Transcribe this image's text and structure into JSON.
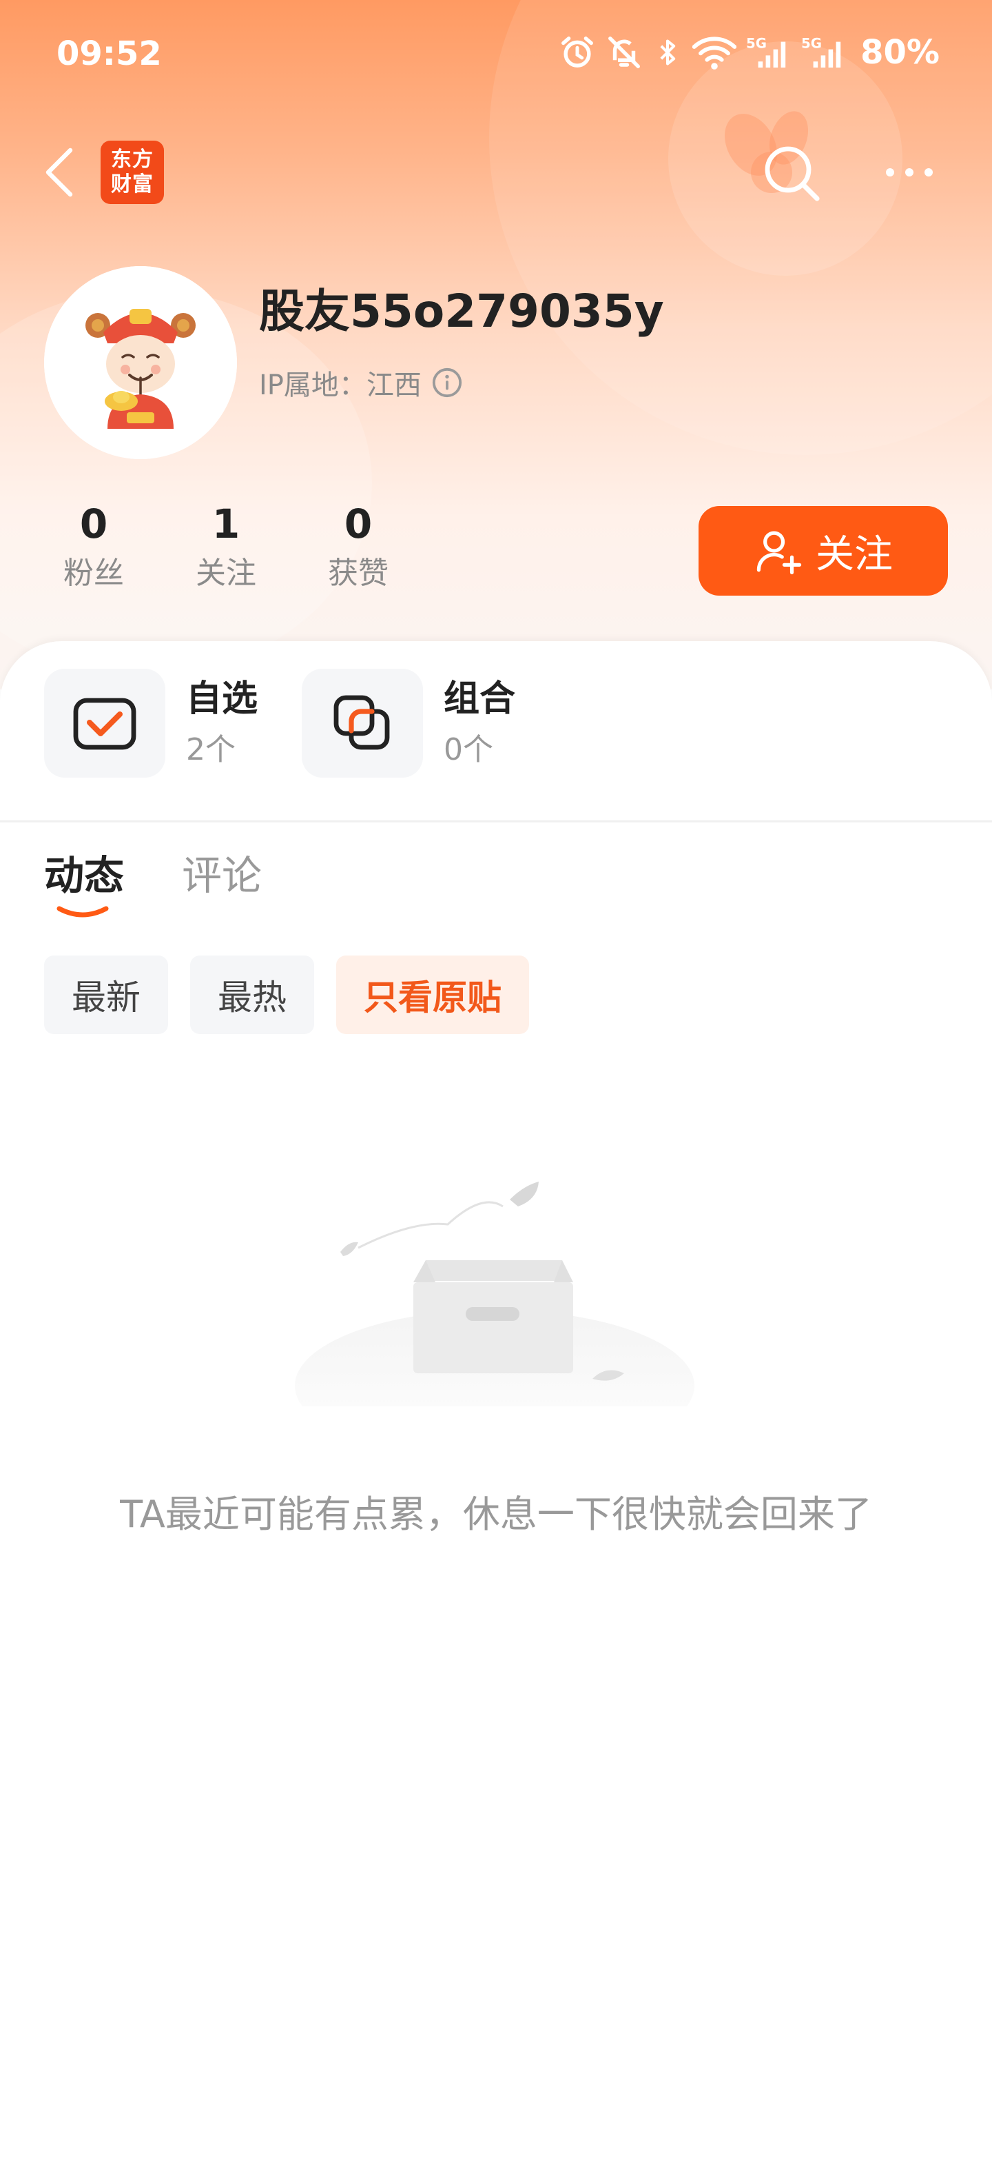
{
  "status_bar": {
    "time": "09:52",
    "battery": "80%",
    "icons": [
      "alarm-icon",
      "mute-icon",
      "bluetooth-icon",
      "wifi-icon",
      "signal-5g-icon",
      "signal-5g-icon"
    ],
    "network_label": "5G"
  },
  "nav": {
    "logo_line1": "东方",
    "logo_line2": "财富",
    "logo_color": "#f24a19"
  },
  "profile": {
    "username": "股友55o279035y",
    "ip_label": "IP属地：江西"
  },
  "stats": [
    {
      "value": "0",
      "label": "粉丝"
    },
    {
      "value": "1",
      "label": "关注"
    },
    {
      "value": "0",
      "label": "获赞"
    }
  ],
  "follow_button": {
    "label": "关注",
    "color": "#ff5a14"
  },
  "assets": [
    {
      "title": "自选",
      "count": "2个",
      "icon": "watchlist-check-icon"
    },
    {
      "title": "组合",
      "count": "0个",
      "icon": "portfolio-icon"
    }
  ],
  "tabs": [
    {
      "label": "动态",
      "active": true
    },
    {
      "label": "评论",
      "active": false
    }
  ],
  "filters": [
    {
      "label": "最新",
      "active": false
    },
    {
      "label": "最热",
      "active": false
    },
    {
      "label": "只看原贴",
      "active": true
    }
  ],
  "empty_state": {
    "message": "TA最近可能有点累，休息一下很快就会回来了"
  },
  "colors": {
    "accent": "#ff5a14",
    "header_gradient_top": "#ff9a62"
  }
}
